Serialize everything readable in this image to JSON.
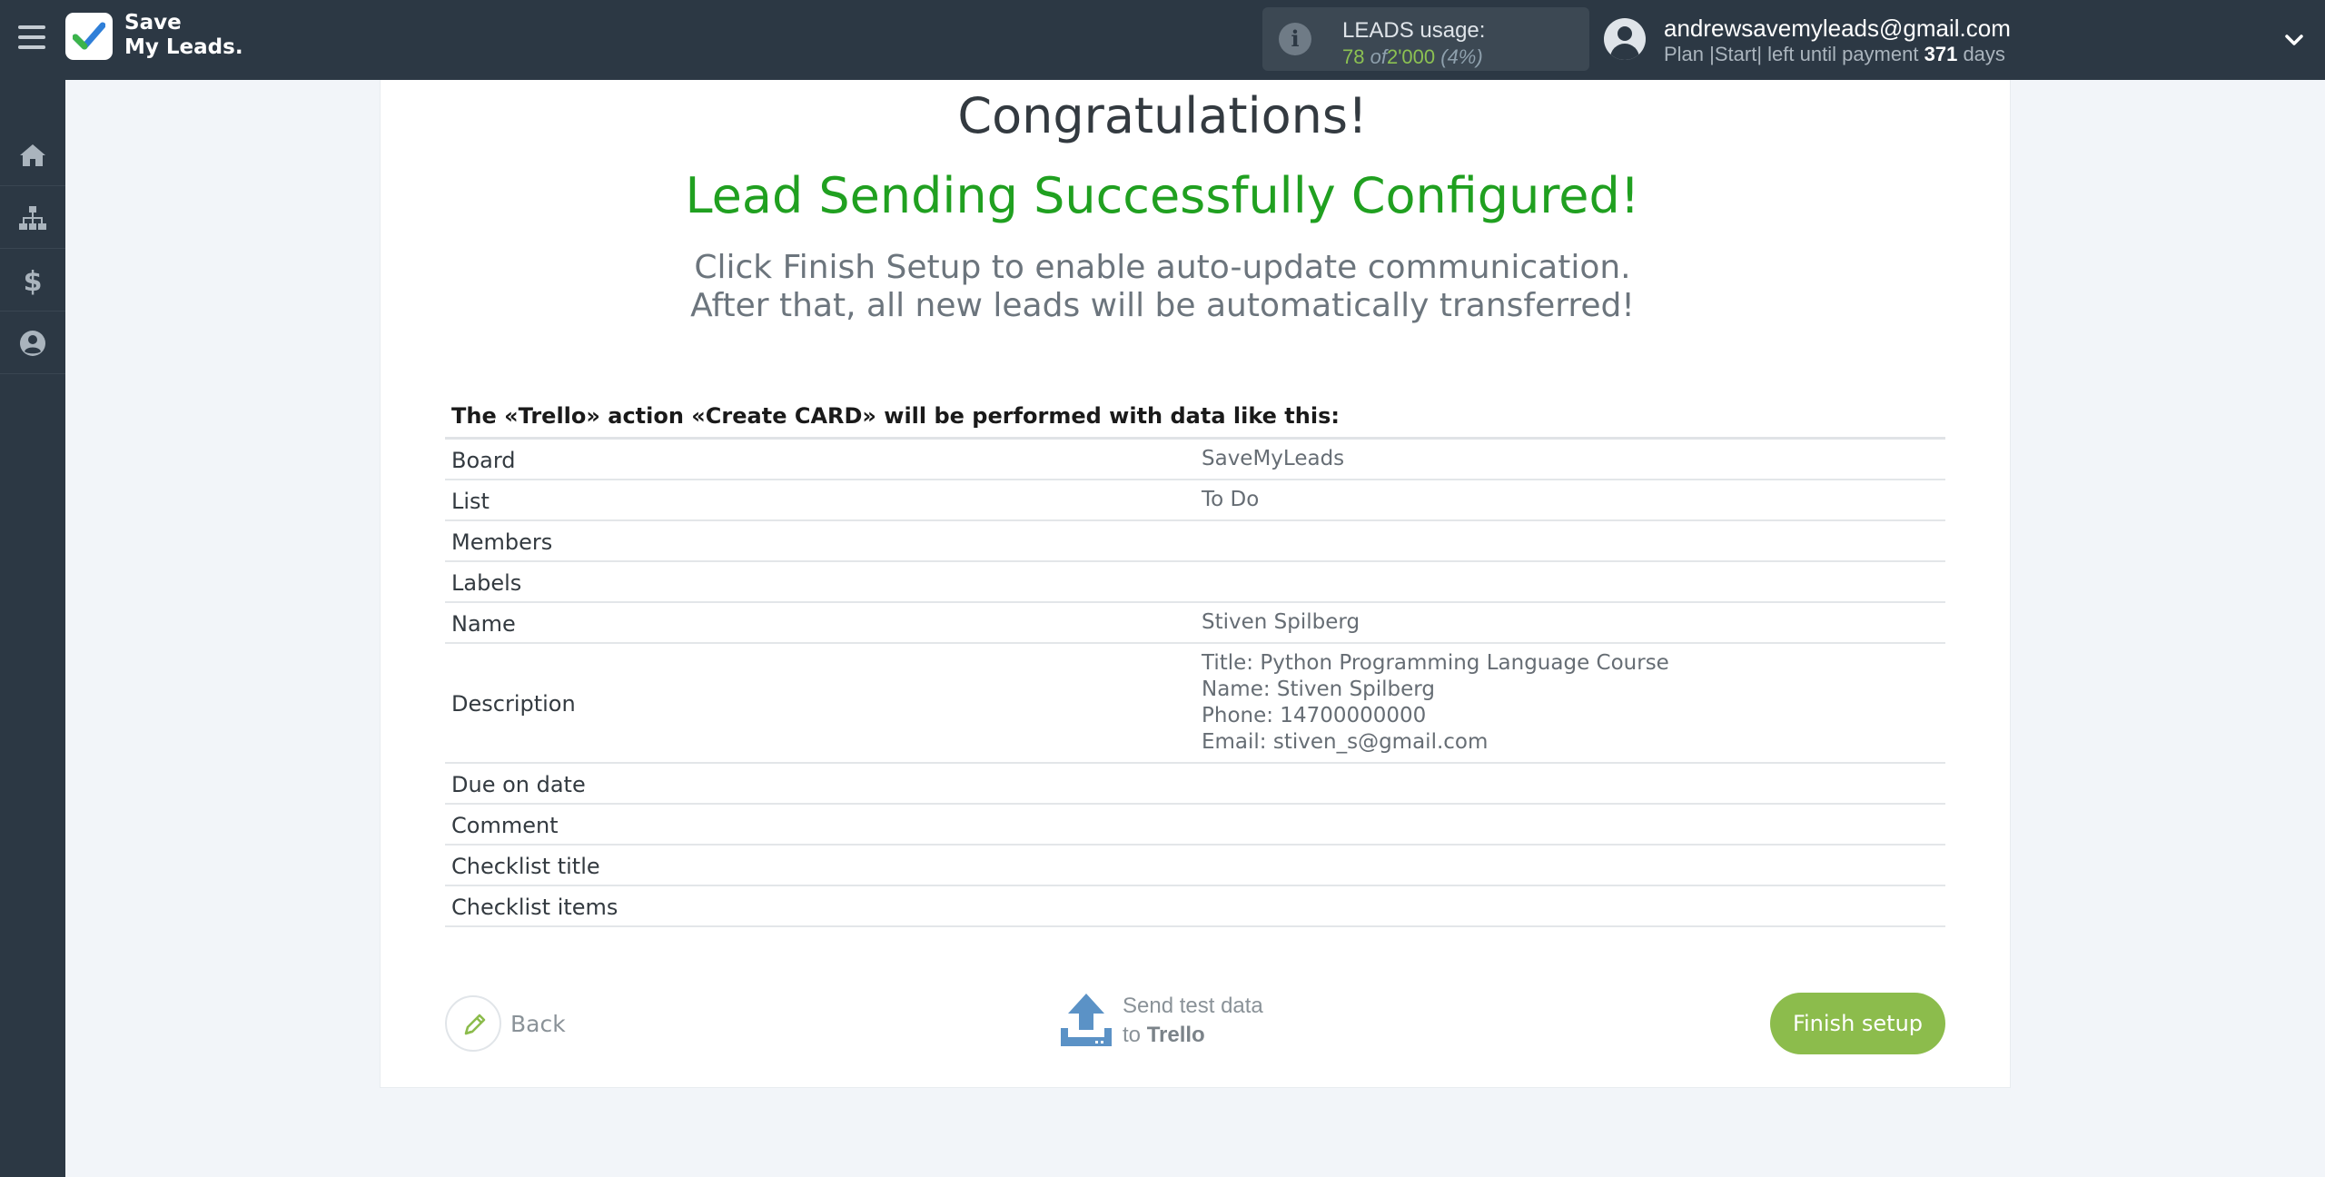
{
  "header": {
    "logo_line1": "Save",
    "logo_line2": "My Leads.",
    "usage_label": "LEADS usage:",
    "usage_used": "78",
    "usage_of": "of",
    "usage_total": "2'000",
    "usage_percent": "(4%)",
    "user_email": "andrewsavemyleads@gmail.com",
    "plan_text": "Plan |Start| left until payment",
    "plan_days": "371",
    "plan_days_unit": "days"
  },
  "sidebar": {
    "items": [
      {
        "icon": "home-icon"
      },
      {
        "icon": "sitemap-icon"
      },
      {
        "icon": "dollar-icon"
      },
      {
        "icon": "user-circle-icon"
      }
    ]
  },
  "main": {
    "title": "Congratulations!",
    "subtitle": "Lead Sending Successfully Configured!",
    "hint_line1": "Click Finish Setup to enable auto-update communication.",
    "hint_line2": "After that, all new leads will be automatically transferred!",
    "table_title": "The «Trello» action «Create CARD» will be performed with data like this:",
    "rows": [
      {
        "key": "Board",
        "value": "SaveMyLeads"
      },
      {
        "key": "List",
        "value": "To Do"
      },
      {
        "key": "Members",
        "value": ""
      },
      {
        "key": "Labels",
        "value": ""
      },
      {
        "key": "Name",
        "value": "Stiven Spilberg"
      },
      {
        "key": "Description",
        "value_lines": [
          "Title: Python Programming Language Course",
          "Name: Stiven Spilberg",
          "Phone: 14700000000",
          "Email: stiven_s@gmail.com"
        ]
      },
      {
        "key": "Due on date",
        "value": ""
      },
      {
        "key": "Comment",
        "value": ""
      },
      {
        "key": "Checklist title",
        "value": ""
      },
      {
        "key": "Checklist items",
        "value": ""
      }
    ]
  },
  "footer": {
    "back_label": "Back",
    "send_line1": "Send test data",
    "send_to": "to",
    "send_target": "Trello",
    "finish_label": "Finish setup"
  },
  "colors": {
    "topbar": "#2c3844",
    "success_green": "#20a020",
    "finish_button": "#8cbc4c",
    "send_icon_blue": "#5b92c6"
  }
}
